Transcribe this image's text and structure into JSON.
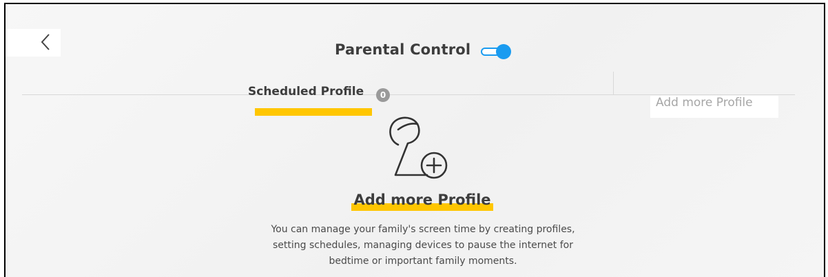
{
  "header": {
    "title": "Parental Control",
    "toggle_on": true,
    "accent_color": "#1a9bf0"
  },
  "nav": {
    "back_icon": "chevron-left-icon"
  },
  "tabs": {
    "scheduled_label": "Scheduled Profile",
    "scheduled_count": "0",
    "add_label": "Add more Profile"
  },
  "empty_state": {
    "icon": "add-profile-icon",
    "cta_label": "Add more Profile",
    "description_lines": [
      "You can manage your family's screen time by creating profiles,",
      "setting schedules, managing devices to pause the internet for",
      "bedtime or important family moments."
    ]
  },
  "colors": {
    "highlight": "#ffc600",
    "badge": "#9a9a9a",
    "text": "#3d3d3d"
  }
}
